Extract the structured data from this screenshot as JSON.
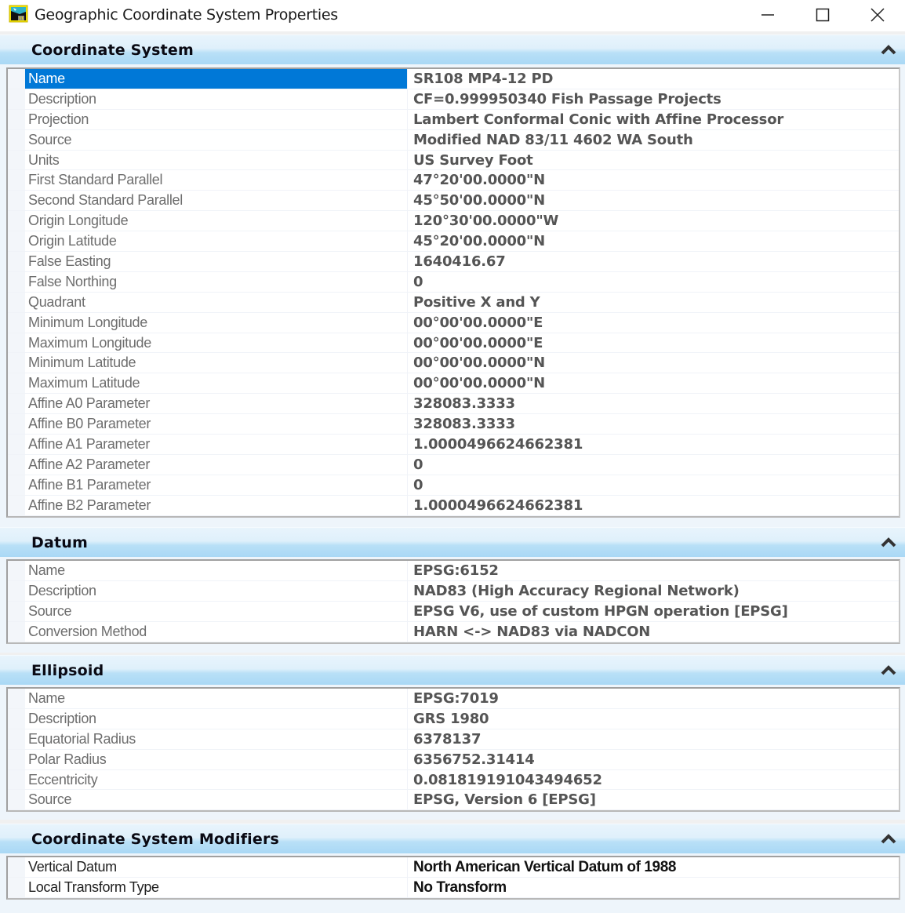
{
  "window": {
    "title": "Geographic Coordinate System Properties",
    "icon": "geocoordinate-app-icon",
    "controls": {
      "minimize": "minimize-icon",
      "maximize": "maximize-icon",
      "close": "close-icon"
    }
  },
  "colors": {
    "selection": "#0078d7",
    "header_gradient_top": "#e8f4fc",
    "header_gradient_bottom": "#a9d8f5",
    "label_text": "#6d6d6d",
    "value_text": "#555555"
  },
  "sections": [
    {
      "title": "Coordinate System",
      "collapse_icon": "chevron-up-icon",
      "rows": [
        {
          "label": "Name",
          "value": "SR108 MP4-12 PD",
          "selected": true
        },
        {
          "label": "Description",
          "value": "CF=0.999950340 Fish Passage Projects"
        },
        {
          "label": "Projection",
          "value": "Lambert Conformal Conic with Affine Processor"
        },
        {
          "label": "Source",
          "value": "Modified NAD 83/11 4602 WA South"
        },
        {
          "label": "Units",
          "value": "US Survey Foot"
        },
        {
          "label": "First Standard Parallel",
          "value": "47°20'00.0000\"N"
        },
        {
          "label": "Second Standard Parallel",
          "value": "45°50'00.0000\"N"
        },
        {
          "label": "Origin Longitude",
          "value": "120°30'00.0000\"W"
        },
        {
          "label": "Origin Latitude",
          "value": "45°20'00.0000\"N"
        },
        {
          "label": "False Easting",
          "value": "1640416.67"
        },
        {
          "label": "False Northing",
          "value": "0"
        },
        {
          "label": "Quadrant",
          "value": "Positive X and Y"
        },
        {
          "label": "Minimum Longitude",
          "value": "00°00'00.0000\"E"
        },
        {
          "label": "Maximum Longitude",
          "value": "00°00'00.0000\"E"
        },
        {
          "label": "Minimum Latitude",
          "value": "00°00'00.0000\"N"
        },
        {
          "label": "Maximum Latitude",
          "value": "00°00'00.0000\"N"
        },
        {
          "label": "Affine A0 Parameter",
          "value": "328083.3333"
        },
        {
          "label": "Affine B0 Parameter",
          "value": "328083.3333"
        },
        {
          "label": "Affine A1 Parameter",
          "value": "1.0000496624662381"
        },
        {
          "label": "Affine A2 Parameter",
          "value": "0"
        },
        {
          "label": "Affine B1 Parameter",
          "value": "0"
        },
        {
          "label": "Affine B2 Parameter",
          "value": "1.0000496624662381"
        }
      ]
    },
    {
      "title": "Datum",
      "collapse_icon": "chevron-up-icon",
      "rows": [
        {
          "label": "Name",
          "value": "EPSG:6152"
        },
        {
          "label": "Description",
          "value": "NAD83 (High Accuracy Regional Network)"
        },
        {
          "label": "Source",
          "value": "EPSG V6, use of custom HPGN operation [EPSG]"
        },
        {
          "label": "Conversion Method",
          "value": "HARN <-> NAD83 via NADCON"
        }
      ]
    },
    {
      "title": "Ellipsoid",
      "collapse_icon": "chevron-up-icon",
      "rows": [
        {
          "label": "Name",
          "value": "EPSG:7019"
        },
        {
          "label": "Description",
          "value": "GRS 1980"
        },
        {
          "label": "Equatorial Radius",
          "value": "6378137"
        },
        {
          "label": "Polar Radius",
          "value": "6356752.31414"
        },
        {
          "label": "Eccentricity",
          "value": "0.081819191043494652"
        },
        {
          "label": "Source",
          "value": "EPSG, Version 6 [EPSG]"
        }
      ]
    },
    {
      "title": "Coordinate System Modifiers",
      "collapse_icon": "chevron-up-icon",
      "rows": [
        {
          "label": "Vertical Datum",
          "value": "North American Vertical Datum of 1988",
          "dark": true
        },
        {
          "label": "Local Transform Type",
          "value": "No Transform",
          "dark": true
        }
      ]
    }
  ]
}
